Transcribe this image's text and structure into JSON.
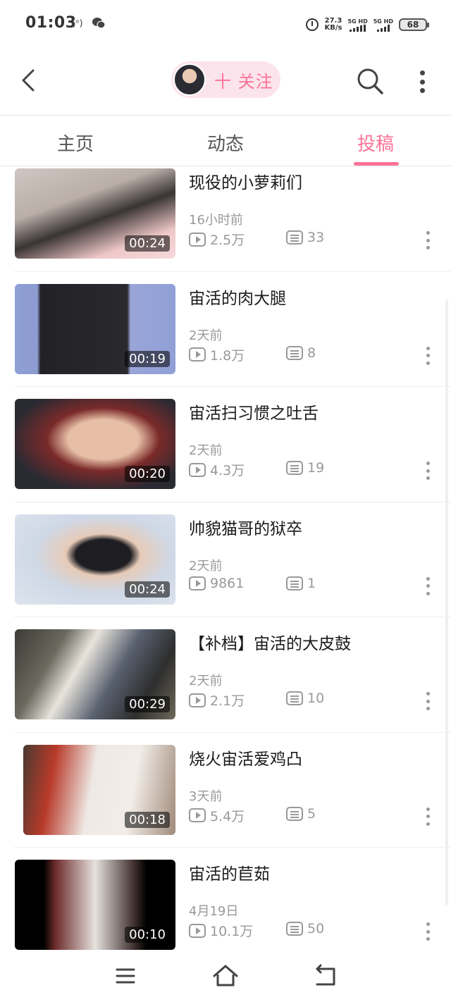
{
  "status_bar": {
    "time": "01:03",
    "hotspot_icon": "(ᵒ)",
    "wechat_icon": "wechat-icon",
    "net_speed_value": "27.3",
    "net_speed_unit": "KB/s",
    "sim1_label": "5G HD",
    "sim2_label": "5G HD",
    "battery": "68"
  },
  "header": {
    "back_icon": "chevron-left-icon",
    "follow_label": "十 关注",
    "search_icon": "search-icon",
    "more_icon": "more-vertical-icon"
  },
  "tabs": [
    {
      "label": "主页",
      "active": false
    },
    {
      "label": "动态",
      "active": false
    },
    {
      "label": "投稿",
      "active": true
    }
  ],
  "accent_color": "#fb7299",
  "videos": [
    {
      "title": "现役的小萝莉们",
      "date": "16小时前",
      "plays": "2.5万",
      "danmaku": "33",
      "duration": "00:24"
    },
    {
      "title": "宙活的肉大腿",
      "date": "2天前",
      "plays": "1.8万",
      "danmaku": "8",
      "duration": "00:19"
    },
    {
      "title": "宙活扫习惯之吐舌",
      "date": "2天前",
      "plays": "4.3万",
      "danmaku": "19",
      "duration": "00:20"
    },
    {
      "title": "帅貌猫哥的狱卒",
      "date": "2天前",
      "plays": "9861",
      "danmaku": "1",
      "duration": "00:24"
    },
    {
      "title": "【补档】宙活的大皮鼓",
      "date": "2天前",
      "plays": "2.1万",
      "danmaku": "10",
      "duration": "00:29"
    },
    {
      "title": "烧火宙活爱鸡凸",
      "date": "3天前",
      "plays": "5.4万",
      "danmaku": "5",
      "duration": "00:18"
    },
    {
      "title": "宙活的苣茹",
      "date": "4月19日",
      "plays": "10.1万",
      "danmaku": "50",
      "duration": "00:10"
    }
  ],
  "nav_bar": {
    "menu_icon": "menu-icon",
    "home_icon": "home-icon",
    "back_icon": "back-return-icon"
  }
}
